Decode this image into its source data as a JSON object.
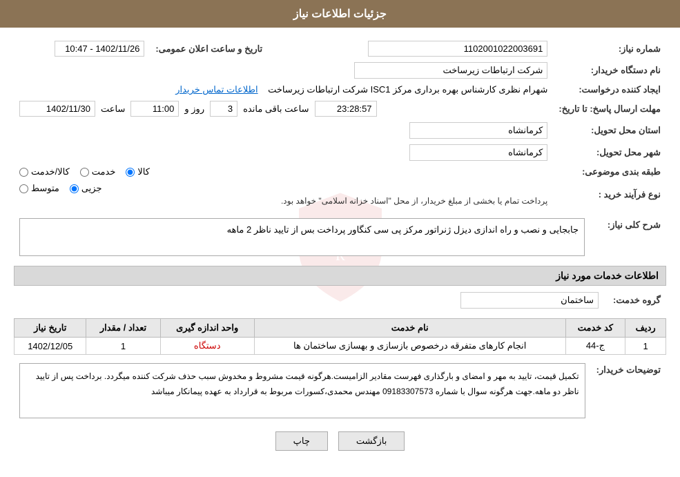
{
  "page": {
    "title": "جزئیات اطلاعات نیاز"
  },
  "fields": {
    "need_number_label": "شماره نیاز:",
    "need_number_value": "1102001022003691",
    "buyer_org_label": "نام دستگاه خریدار:",
    "buyer_org_value": "شرکت ارتباطات زیرساخت",
    "creator_label": "ایجاد کننده درخواست:",
    "creator_value": "شهرام نظری کارشناس بهره برداری مرکز ISC1 شرکت ارتباطات زیرساخت",
    "creator_link": "اطلاعات تماس خریدار",
    "send_deadline_label": "مهلت ارسال پاسخ: تا تاریخ:",
    "date_value": "1402/11/30",
    "time_label": "ساعت",
    "time_value": "11:00",
    "days_label": "روز و",
    "days_value": "3",
    "remaining_label": "ساعت باقی مانده",
    "remaining_value": "23:28:57",
    "delivery_province_label": "استان محل تحویل:",
    "delivery_province_value": "کرمانشاه",
    "delivery_city_label": "شهر محل تحویل:",
    "delivery_city_value": "کرمانشاه",
    "category_label": "طبقه بندی موضوعی:",
    "category_options": [
      "کالا",
      "خدمت",
      "کالا/خدمت"
    ],
    "category_selected": "کالا",
    "purchase_type_label": "نوع فرآیند خرید :",
    "purchase_options": [
      "جزیی",
      "متوسط"
    ],
    "purchase_note": "پرداخت تمام یا بخشی از مبلغ خریدار، از محل \"اسناد خزانه اسلامی\" خواهد بود.",
    "public_announce_label": "تاریخ و ساعت اعلان عمومی:",
    "public_announce_value": "1402/11/26 - 10:47",
    "need_description_label": "شرح کلی نیاز:",
    "need_description_value": "جابجایی و نصب و راه اندازی دیزل ژنراتور مرکز پی سی کنگاور پرداخت بس از تایید ناظر 2 ماهه",
    "services_section_label": "اطلاعات خدمات مورد نیاز",
    "service_group_label": "گروه خدمت:",
    "service_group_value": "ساختمان"
  },
  "table": {
    "headers": [
      "ردیف",
      "کد خدمت",
      "نام خدمت",
      "واحد اندازه گیری",
      "تعداد / مقدار",
      "تاریخ نیاز"
    ],
    "rows": [
      {
        "row_num": "1",
        "service_code": "ج-44",
        "service_name": "انجام کارهای متفرقه درخصوص بازسازی و بهسازی ساختمان ها",
        "unit": "دستگاه",
        "quantity": "1",
        "date": "1402/12/05"
      }
    ]
  },
  "buyer_notes_label": "توضیحات خریدار:",
  "buyer_notes_value": "تکمیل قیمت، تایید به مهر و امضای و بارگذاری فهرست مقادیر الزامیست.هرگونه قیمت مشروط و مخدوش سبب حذف شرکت کننده میگردد. برداخت پس از تایید ناظر دو ماهه.جهت هرگونه سوال با شماره 09183307573 مهندس محمدی،کسورات مربوط به قرارداد به عهده پیمانکار میباشد",
  "buttons": {
    "print_label": "چاپ",
    "back_label": "بازگشت"
  }
}
